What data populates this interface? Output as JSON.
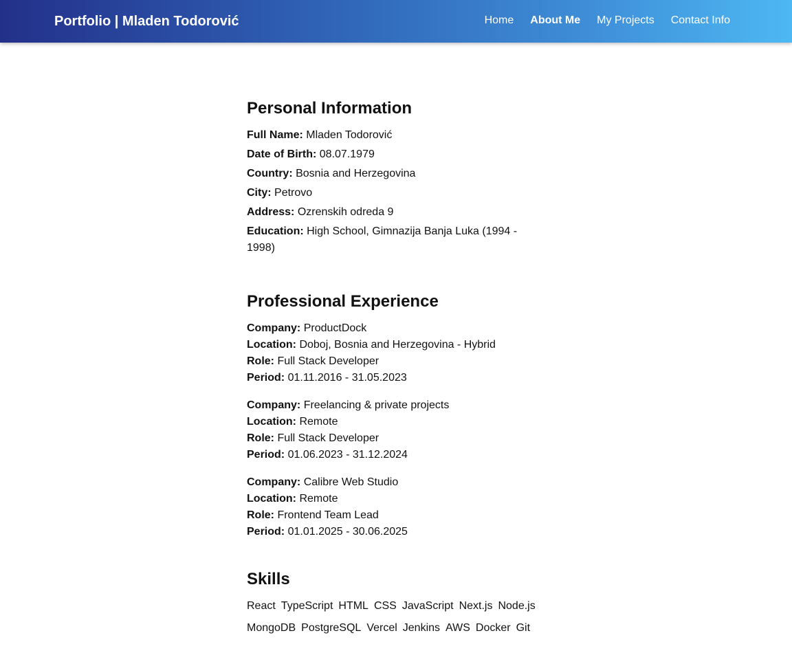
{
  "nav": {
    "brand": "Portfolio | Mladen Todorović",
    "links": [
      {
        "label": "Home"
      },
      {
        "label": "About Me"
      },
      {
        "label": "My Projects"
      },
      {
        "label": "Contact Info"
      }
    ],
    "active": "About Me"
  },
  "personal": {
    "title": "Personal Information",
    "fields": [
      {
        "label": "Full Name:",
        "value": "Mladen Todorović"
      },
      {
        "label": "Date of Birth:",
        "value": "08.07.1979"
      },
      {
        "label": "Country:",
        "value": "Bosnia and Herzegovina"
      },
      {
        "label": "City:",
        "value": "Petrovo"
      },
      {
        "label": "Address:",
        "value": "Ozrenskih odreda 9"
      },
      {
        "label": "Education:",
        "value": "High School, Gimnazija Banja Luka (1994 - 1998)"
      }
    ]
  },
  "experience": {
    "title": "Professional Experience",
    "labels": {
      "company": "Company:",
      "location": "Location:",
      "role": "Role:",
      "period": "Period:"
    },
    "jobs": [
      {
        "company": "ProductDock",
        "location": "Doboj, Bosnia and Herzegovina - Hybrid",
        "role": "Full Stack Developer",
        "period": "01.11.2016 - 31.05.2023"
      },
      {
        "company": "Freelancing & private projects",
        "location": "Remote",
        "role": "Full Stack Developer",
        "period": "01.06.2023 - 31.12.2024"
      },
      {
        "company": "Calibre Web Studio",
        "location": "Remote",
        "role": "Frontend Team Lead",
        "period": "01.01.2025 - 30.06.2025"
      }
    ]
  },
  "skills": {
    "title": "Skills",
    "items": [
      "React",
      "TypeScript",
      "HTML",
      "CSS",
      "JavaScript",
      "Next.js",
      "Node.js",
      "MongoDB",
      "PostgreSQL",
      "Vercel",
      "Jenkins",
      "AWS",
      "Docker",
      "Git"
    ]
  },
  "colors": {
    "nav_gradient_start": "#23308a",
    "nav_gradient_end": "#4db8f3",
    "text": "#111111",
    "background": "#ffffff"
  }
}
